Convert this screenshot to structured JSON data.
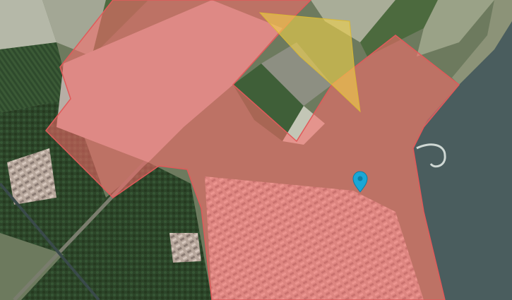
{
  "map": {
    "view": "satellite",
    "colors": {
      "water": "#4a5d5e",
      "forest": "#2f4a2c",
      "farmland_light": "#a9ad98",
      "farmland_dark": "#4c6a3e",
      "zone_fill": "#ff6b6b",
      "zone_stroke": "#e05a5a",
      "overlay_fill": "#f2d24a",
      "marker": "#1aa7d6"
    },
    "layers": [
      {
        "name": "red-zone",
        "style": "semi-transparent polygon"
      },
      {
        "name": "yellow-area",
        "style": "semi-transparent polygon"
      }
    ],
    "marker": {
      "icon": "map-pin-icon"
    }
  }
}
